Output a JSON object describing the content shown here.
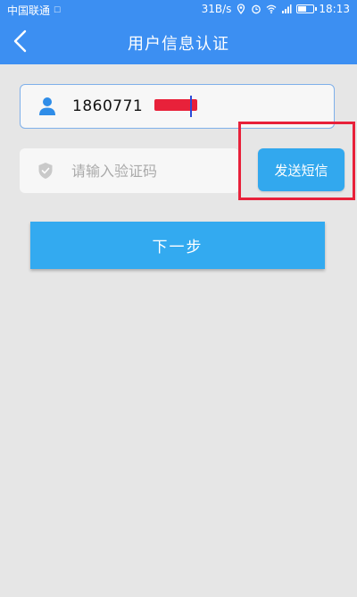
{
  "status_bar": {
    "carrier": "中国联通",
    "network_speed": "31B/s",
    "time": "18:13",
    "battery_level": 0.45
  },
  "header": {
    "title": "用户信息认证",
    "back_icon": "chevron-left-icon"
  },
  "form": {
    "phone": {
      "value": "1860771",
      "icon": "user-icon",
      "value_redacted": true
    },
    "code": {
      "placeholder": "请输入验证码",
      "value": "",
      "icon": "shield-icon"
    },
    "send_sms_label": "发送短信",
    "next_label": "下一步"
  },
  "colors": {
    "header_bg": "#3c8ff2",
    "button_bg": "#33aaf0",
    "page_bg": "#e6e6e6",
    "highlight": "#e8213a",
    "redaction": "#e8213a"
  }
}
